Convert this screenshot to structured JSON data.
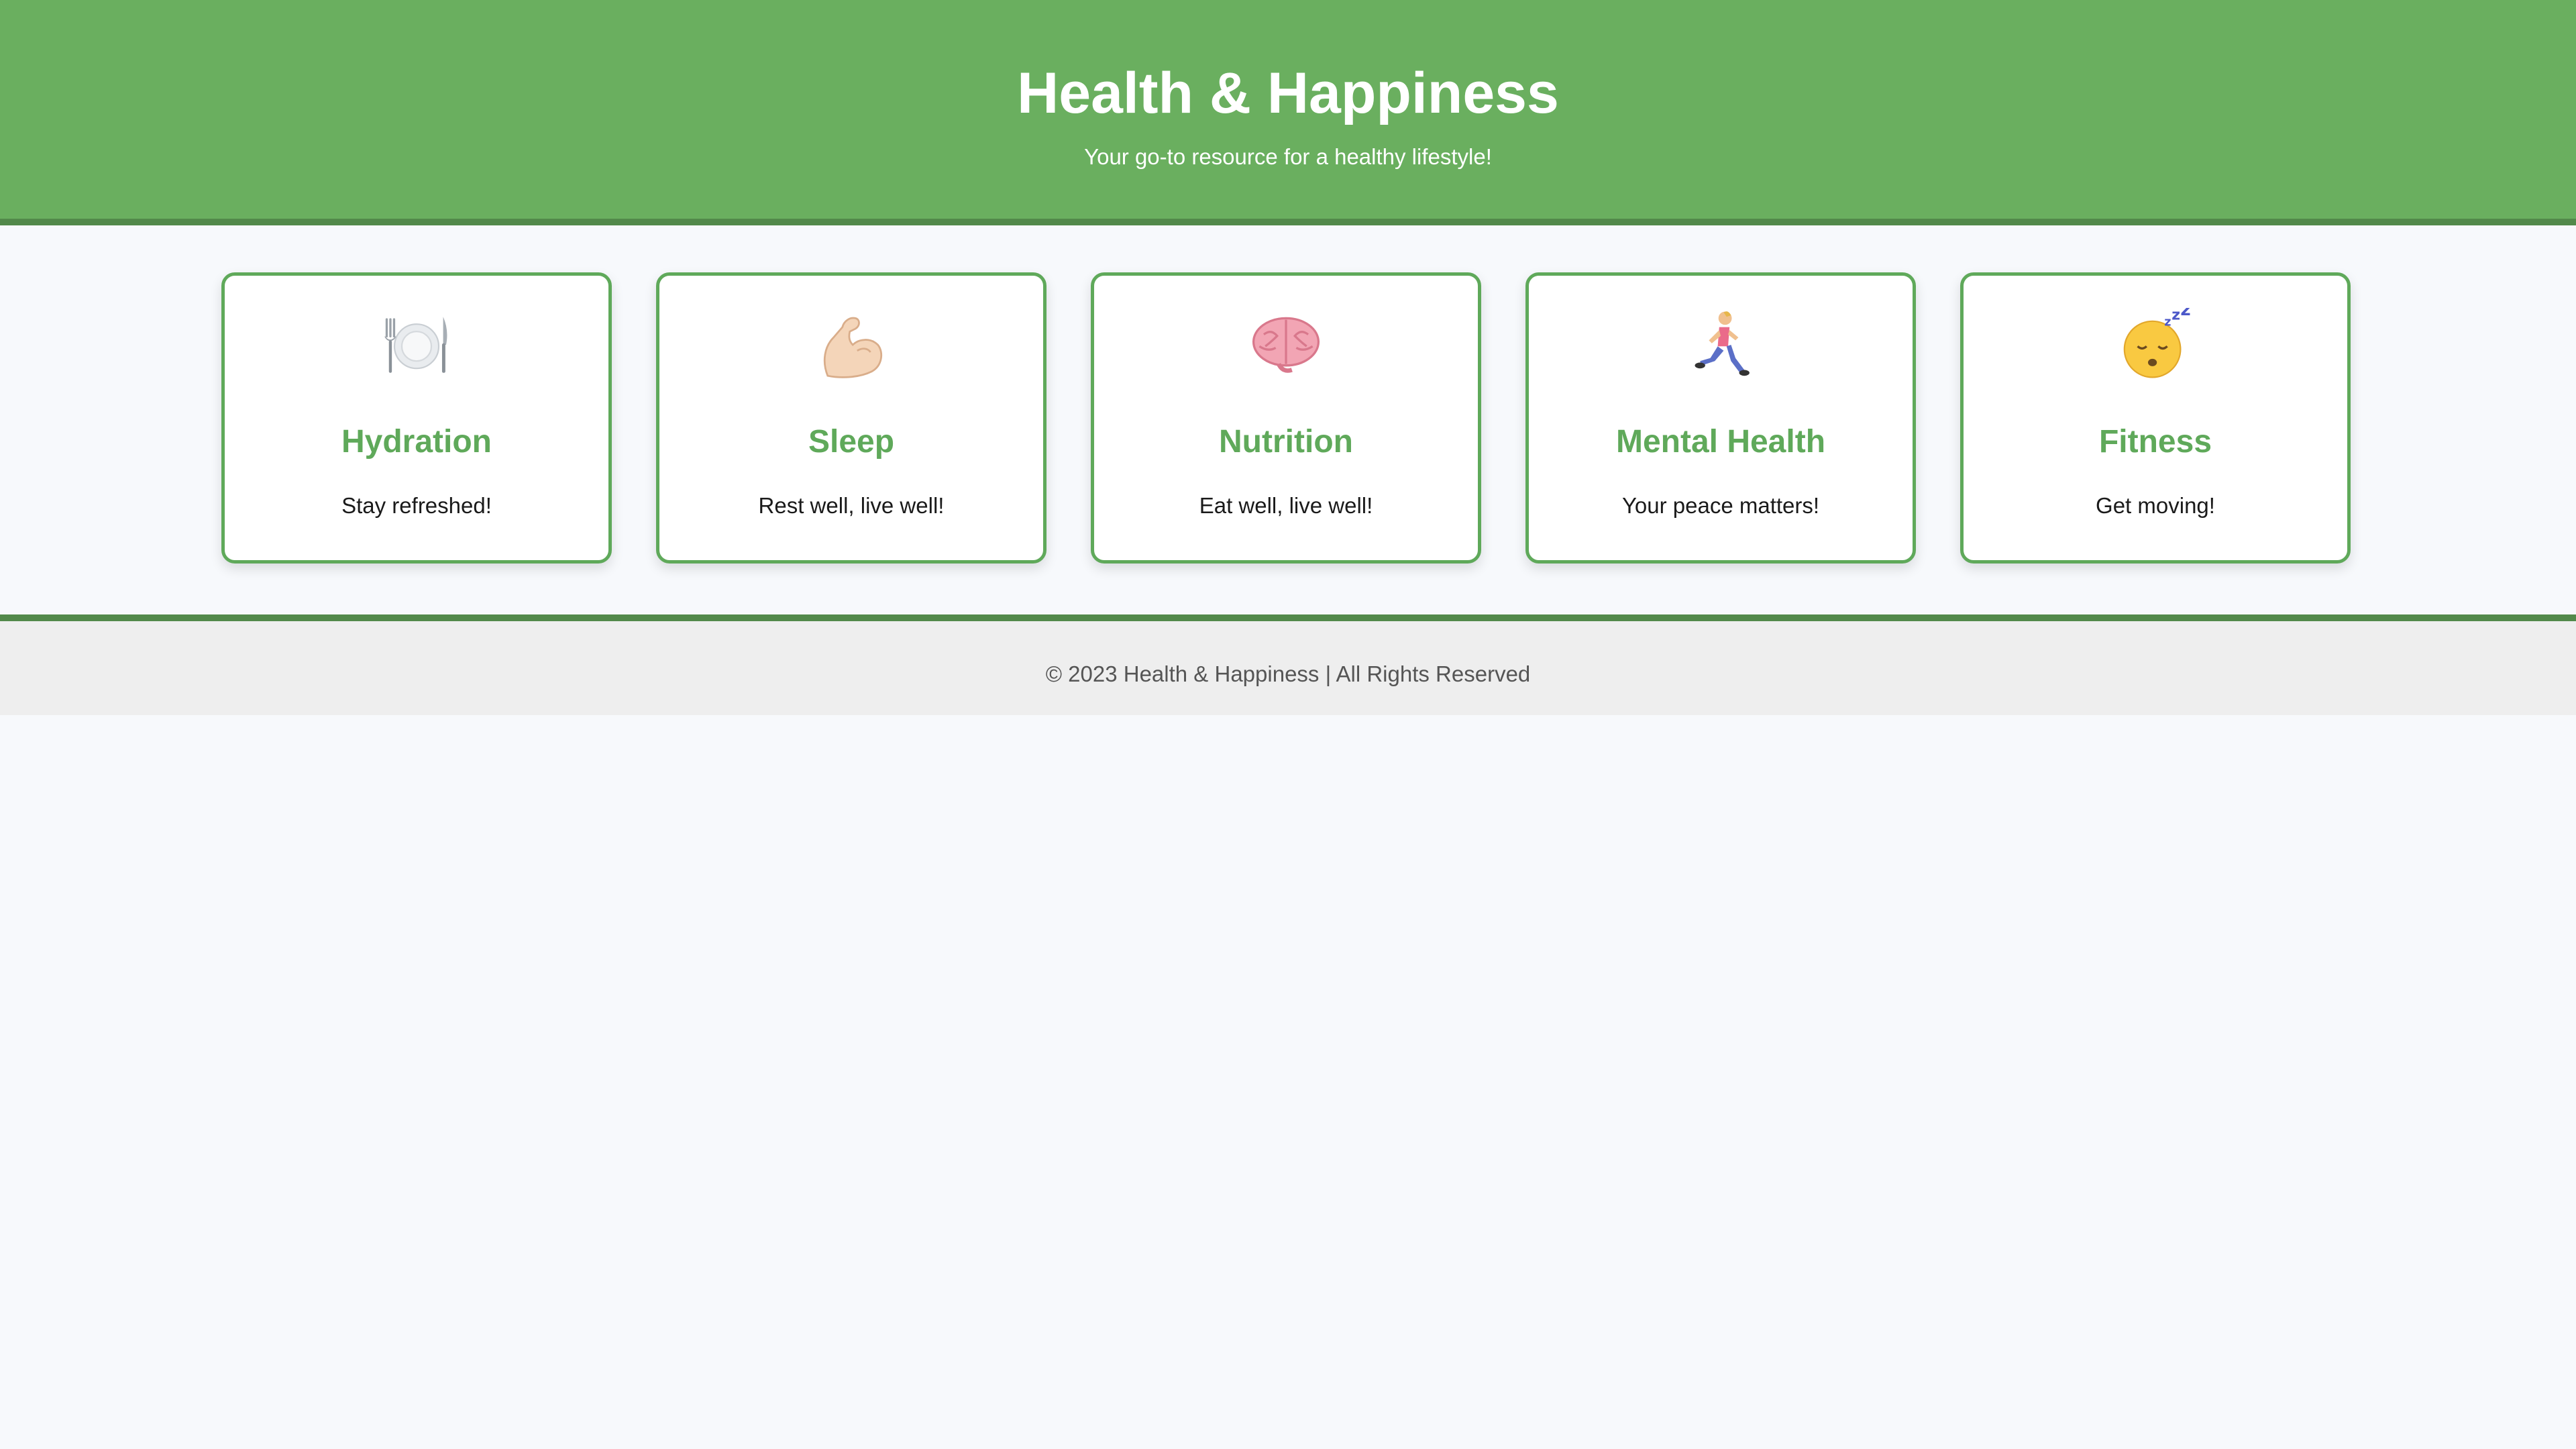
{
  "header": {
    "title": "Health & Happiness",
    "tagline": "Your go-to resource for a healthy lifestyle!"
  },
  "cards": [
    {
      "icon": "plate-fork-knife-icon",
      "title": "Hydration",
      "description": "Stay refreshed!"
    },
    {
      "icon": "flexed-bicep-icon",
      "title": "Sleep",
      "description": "Rest well, live well!"
    },
    {
      "icon": "brain-icon",
      "title": "Nutrition",
      "description": "Eat well, live well!"
    },
    {
      "icon": "running-person-icon",
      "title": "Mental Health",
      "description": "Your peace matters!"
    },
    {
      "icon": "sleeping-face-icon",
      "title": "Fitness",
      "description": "Get moving!"
    }
  ],
  "footer": {
    "text": "© 2023 Health & Happiness | All Rights Reserved"
  },
  "colors": {
    "header_bg": "#6aaf5f",
    "header_border": "#52894a",
    "accent": "#5fa95a",
    "page_bg": "#f7f9fc",
    "footer_bg": "#eeeeee"
  }
}
